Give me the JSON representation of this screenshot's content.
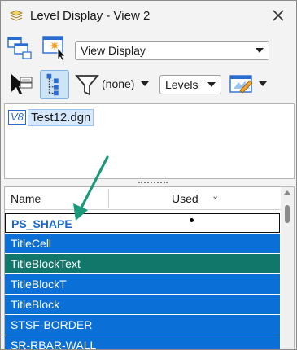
{
  "window": {
    "title": "Level Display - View 2"
  },
  "toolbar": {
    "view_mode_value": "View Display",
    "filter_value": "(none)",
    "levels_value": "Levels"
  },
  "files": {
    "badge": "V8",
    "name": "Test12.dgn"
  },
  "level_list": {
    "columns": {
      "name": "Name",
      "used": "Used"
    },
    "rows": [
      {
        "name": "PS_SHAPE",
        "used": true,
        "state": "focused"
      },
      {
        "name": "TitleCell",
        "used": false,
        "state": "selected"
      },
      {
        "name": "TitleBlockText",
        "used": false,
        "state": "selected-hover"
      },
      {
        "name": "TitleBlockT",
        "used": false,
        "state": "selected"
      },
      {
        "name": "TitleBlock",
        "used": false,
        "state": "selected"
      },
      {
        "name": "STSF-BORDER",
        "used": false,
        "state": "selected"
      },
      {
        "name": "SR-RBAR-WALL",
        "used": false,
        "state": "selected"
      }
    ]
  },
  "colors": {
    "selection": "#0a6fd6",
    "hover_selection": "#10776a",
    "focused_text": "#1a66c9",
    "annotation_arrow": "#1a9a7a"
  },
  "icons": {
    "title": "layers-icon",
    "close": "close-icon",
    "views": "view-windows-icon",
    "highlight_view": "highlight-view-icon",
    "pointer": "select-pointer-icon",
    "tree": "tree-hierarchy-icon",
    "filter": "funnel-filter-icon",
    "display": "display-mode-icon"
  }
}
